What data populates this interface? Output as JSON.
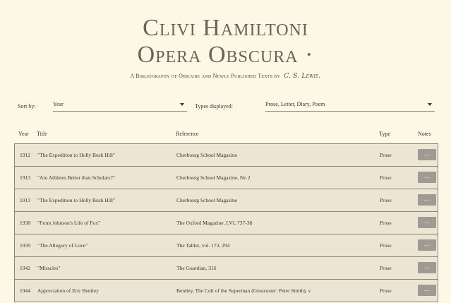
{
  "header": {
    "title_line1": "Clivi Hamiltoni",
    "title_line2": "Opera Obscura ·",
    "subtitle": "A Bibliography of Obscure and Newly Published Texts by",
    "signature": "C. S. Lewis."
  },
  "controls": {
    "sort_label": "Sort by:",
    "sort_value": "Year",
    "types_label": "Types displayed:",
    "types_value": "Prose, Letter, Diary, Poem"
  },
  "table": {
    "columns": [
      "Year",
      "Title",
      "Reference",
      "Type",
      "Notes"
    ],
    "notes_button_label": "···",
    "rows": [
      {
        "year": "1912",
        "title": "\"The Expedition to Holly Bush Hill\"",
        "reference": "Cherbourg School Magazine",
        "type": "Prose"
      },
      {
        "year": "1913",
        "title": "\"Are Athletes Better than Scholars?\"",
        "reference": "Cherbourg School Magazine, No 2",
        "type": "Prose"
      },
      {
        "year": "1913",
        "title": "\"The Expedition to Holly Bush Hill\"",
        "reference": "Cherbourg School Magazine",
        "type": "Prose"
      },
      {
        "year": "1938",
        "title": "\"From Johnson's Life of Fox\"",
        "reference": "The Oxford Magazine, LVI, 737-38",
        "type": "Prose"
      },
      {
        "year": "1939",
        "title": "\"The Allegory of Love\"",
        "reference": "The Tablet, vol. 173, 294",
        "type": "Prose"
      },
      {
        "year": "1942",
        "title": "\"Miracles\"",
        "reference": "The Guardian, 316",
        "type": "Prose"
      },
      {
        "year": "1944",
        "title": "Appreciation of Eric Bentley",
        "reference": "Bentley, The Cult of the Superman (Gloucester: Peter Smith), v",
        "type": "Prose"
      }
    ]
  }
}
